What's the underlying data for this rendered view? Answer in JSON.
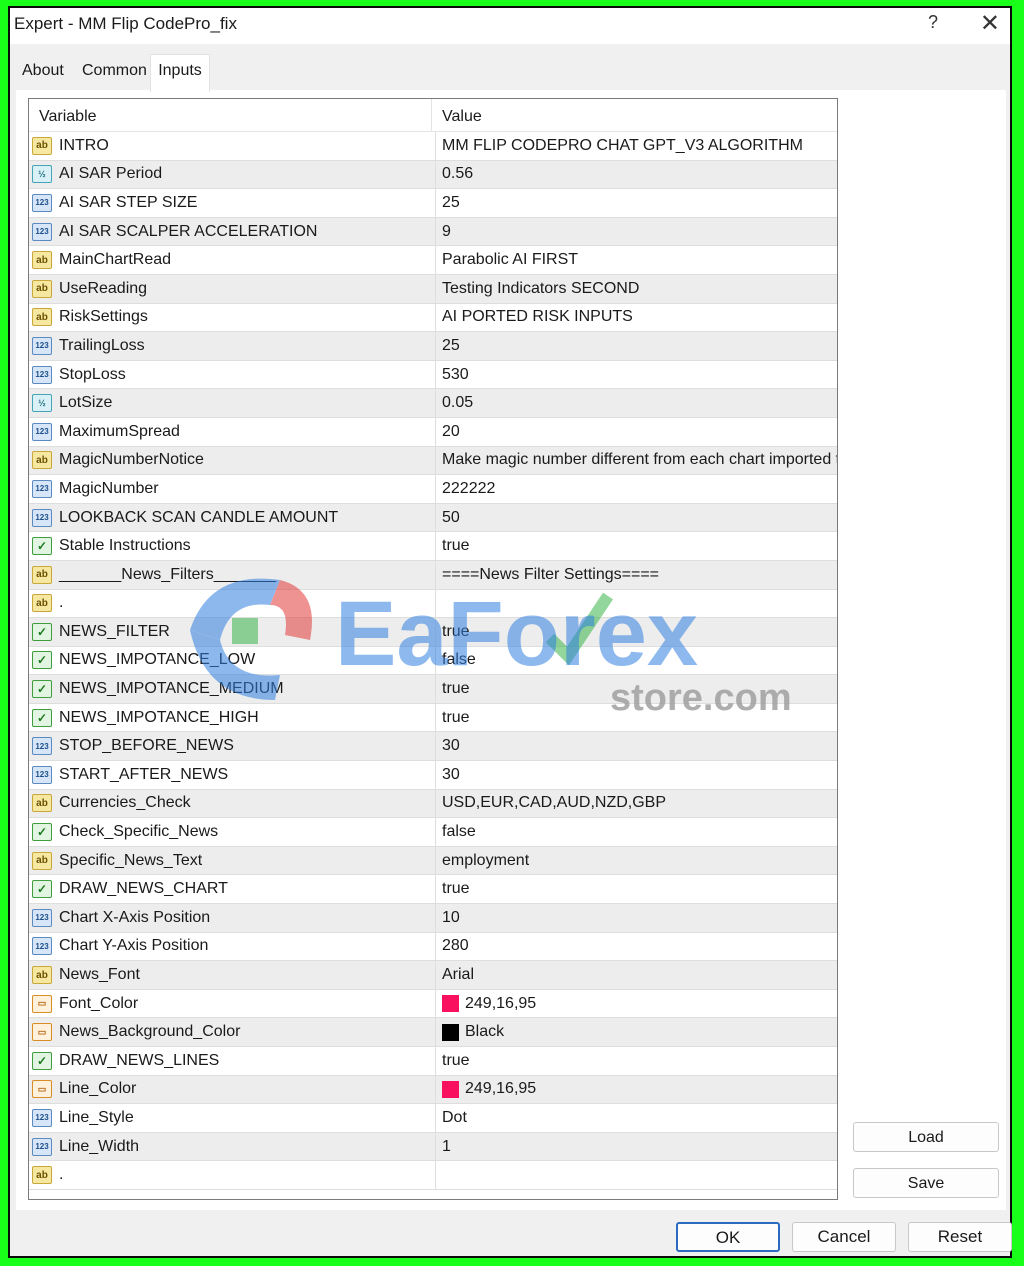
{
  "window": {
    "title": "Expert - MM Flip CodePro_fix",
    "help_label": "?",
    "close_label": "✕"
  },
  "tabs": [
    {
      "label": "About"
    },
    {
      "label": "Common"
    },
    {
      "label": "Inputs"
    }
  ],
  "grid": {
    "headers": {
      "variable": "Variable",
      "value": "Value"
    },
    "rows": [
      {
        "type": "ab",
        "icon": "string-icon",
        "name": "INTRO",
        "value": "MM FLIP CODEPRO CHAT GPT_V3 ALGORITHM"
      },
      {
        "type": "half",
        "icon": "double-icon",
        "name": "AI SAR Period",
        "value": "0.56"
      },
      {
        "type": "123",
        "icon": "integer-icon",
        "name": "AI SAR STEP SIZE",
        "value": "25"
      },
      {
        "type": "123",
        "icon": "integer-icon",
        "name": "AI SAR SCALPER ACCELERATION",
        "value": "9"
      },
      {
        "type": "ab",
        "icon": "string-icon",
        "name": "MainChartRead",
        "value": "Parabolic AI FIRST"
      },
      {
        "type": "ab",
        "icon": "string-icon",
        "name": "UseReading",
        "value": "Testing Indicators SECOND"
      },
      {
        "type": "ab",
        "icon": "string-icon",
        "name": "RiskSettings",
        "value": "AI PORTED RISK INPUTS"
      },
      {
        "type": "123",
        "icon": "integer-icon",
        "name": "TrailingLoss",
        "value": "25"
      },
      {
        "type": "123",
        "icon": "integer-icon",
        "name": "StopLoss",
        "value": "530"
      },
      {
        "type": "half",
        "icon": "double-icon",
        "name": "LotSize",
        "value": "0.05"
      },
      {
        "type": "123",
        "icon": "integer-icon",
        "name": "MaximumSpread",
        "value": "20"
      },
      {
        "type": "ab",
        "icon": "string-icon",
        "name": "MagicNumberNotice",
        "value": "Make magic number different from each chart imported to"
      },
      {
        "type": "123",
        "icon": "integer-icon",
        "name": "MagicNumber",
        "value": "222222"
      },
      {
        "type": "123",
        "icon": "integer-icon",
        "name": "LOOKBACK SCAN CANDLE AMOUNT",
        "value": "50"
      },
      {
        "type": "bool",
        "icon": "boolean-icon",
        "name": "Stable Instructions",
        "value": "true"
      },
      {
        "type": "ab",
        "icon": "string-icon",
        "name": "_______News_Filters_______",
        "value": "====News Filter Settings===="
      },
      {
        "type": "ab",
        "icon": "string-icon",
        "name": ".",
        "value": ""
      },
      {
        "type": "bool",
        "icon": "boolean-icon",
        "name": "NEWS_FILTER",
        "value": "true"
      },
      {
        "type": "bool",
        "icon": "boolean-icon",
        "name": "NEWS_IMPOTANCE_LOW",
        "value": "false"
      },
      {
        "type": "bool",
        "icon": "boolean-icon",
        "name": "NEWS_IMPOTANCE_MEDIUM",
        "value": "true"
      },
      {
        "type": "bool",
        "icon": "boolean-icon",
        "name": "NEWS_IMPOTANCE_HIGH",
        "value": "true"
      },
      {
        "type": "123",
        "icon": "integer-icon",
        "name": "STOP_BEFORE_NEWS",
        "value": "30"
      },
      {
        "type": "123",
        "icon": "integer-icon",
        "name": "START_AFTER_NEWS",
        "value": "30"
      },
      {
        "type": "ab",
        "icon": "string-icon",
        "name": "Currencies_Check",
        "value": "USD,EUR,CAD,AUD,NZD,GBP"
      },
      {
        "type": "bool",
        "icon": "boolean-icon",
        "name": "Check_Specific_News",
        "value": "false"
      },
      {
        "type": "ab",
        "icon": "string-icon",
        "name": "Specific_News_Text",
        "value": "employment"
      },
      {
        "type": "bool",
        "icon": "boolean-icon",
        "name": "DRAW_NEWS_CHART",
        "value": "true"
      },
      {
        "type": "123",
        "icon": "integer-icon",
        "name": "Chart X-Axis Position",
        "value": "10"
      },
      {
        "type": "123",
        "icon": "integer-icon",
        "name": "Chart Y-Axis Position",
        "value": "280"
      },
      {
        "type": "ab",
        "icon": "string-icon",
        "name": "News_Font",
        "value": "Arial"
      },
      {
        "type": "color",
        "icon": "color-icon",
        "name": "Font_Color",
        "value": "249,16,95",
        "swatch": "#f9105f"
      },
      {
        "type": "color",
        "icon": "color-icon",
        "name": "News_Background_Color",
        "value": "Black",
        "swatch": "#000000"
      },
      {
        "type": "bool",
        "icon": "boolean-icon",
        "name": "DRAW_NEWS_LINES",
        "value": "true"
      },
      {
        "type": "color",
        "icon": "color-icon",
        "name": "Line_Color",
        "value": "249,16,95",
        "swatch": "#f9105f"
      },
      {
        "type": "123",
        "icon": "integer-icon",
        "name": "Line_Style",
        "value": "Dot"
      },
      {
        "type": "123",
        "icon": "integer-icon",
        "name": "Line_Width",
        "value": "1"
      },
      {
        "type": "ab",
        "icon": "string-icon",
        "name": ".",
        "value": ""
      }
    ]
  },
  "side_buttons": {
    "load": "Load",
    "save": "Save"
  },
  "bottom_buttons": {
    "ok": "OK",
    "cancel": "Cancel",
    "reset": "Reset"
  },
  "watermark": {
    "brand": "EaForex",
    "domain": "store.com"
  },
  "colors": {
    "frame_border": "#1aff1a",
    "accent": "#2a6cc2"
  }
}
